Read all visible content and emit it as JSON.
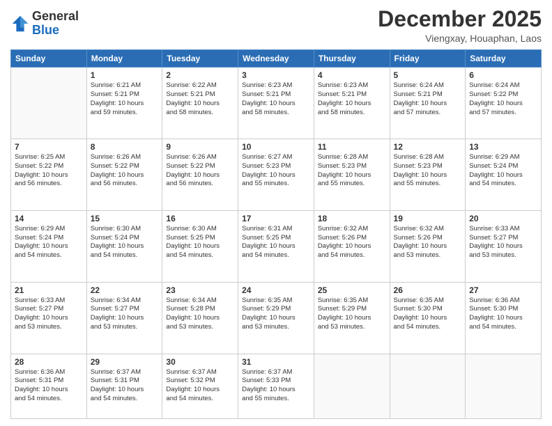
{
  "logo": {
    "general": "General",
    "blue": "Blue"
  },
  "title": "December 2025",
  "subtitle": "Viengxay, Houaphan, Laos",
  "days": [
    "Sunday",
    "Monday",
    "Tuesday",
    "Wednesday",
    "Thursday",
    "Friday",
    "Saturday"
  ],
  "weeks": [
    [
      {
        "day": "",
        "info": ""
      },
      {
        "day": "1",
        "info": "Sunrise: 6:21 AM\nSunset: 5:21 PM\nDaylight: 10 hours\nand 59 minutes."
      },
      {
        "day": "2",
        "info": "Sunrise: 6:22 AM\nSunset: 5:21 PM\nDaylight: 10 hours\nand 58 minutes."
      },
      {
        "day": "3",
        "info": "Sunrise: 6:23 AM\nSunset: 5:21 PM\nDaylight: 10 hours\nand 58 minutes."
      },
      {
        "day": "4",
        "info": "Sunrise: 6:23 AM\nSunset: 5:21 PM\nDaylight: 10 hours\nand 58 minutes."
      },
      {
        "day": "5",
        "info": "Sunrise: 6:24 AM\nSunset: 5:21 PM\nDaylight: 10 hours\nand 57 minutes."
      },
      {
        "day": "6",
        "info": "Sunrise: 6:24 AM\nSunset: 5:22 PM\nDaylight: 10 hours\nand 57 minutes."
      }
    ],
    [
      {
        "day": "7",
        "info": "Sunrise: 6:25 AM\nSunset: 5:22 PM\nDaylight: 10 hours\nand 56 minutes."
      },
      {
        "day": "8",
        "info": "Sunrise: 6:26 AM\nSunset: 5:22 PM\nDaylight: 10 hours\nand 56 minutes."
      },
      {
        "day": "9",
        "info": "Sunrise: 6:26 AM\nSunset: 5:22 PM\nDaylight: 10 hours\nand 56 minutes."
      },
      {
        "day": "10",
        "info": "Sunrise: 6:27 AM\nSunset: 5:23 PM\nDaylight: 10 hours\nand 55 minutes."
      },
      {
        "day": "11",
        "info": "Sunrise: 6:28 AM\nSunset: 5:23 PM\nDaylight: 10 hours\nand 55 minutes."
      },
      {
        "day": "12",
        "info": "Sunrise: 6:28 AM\nSunset: 5:23 PM\nDaylight: 10 hours\nand 55 minutes."
      },
      {
        "day": "13",
        "info": "Sunrise: 6:29 AM\nSunset: 5:24 PM\nDaylight: 10 hours\nand 54 minutes."
      }
    ],
    [
      {
        "day": "14",
        "info": "Sunrise: 6:29 AM\nSunset: 5:24 PM\nDaylight: 10 hours\nand 54 minutes."
      },
      {
        "day": "15",
        "info": "Sunrise: 6:30 AM\nSunset: 5:24 PM\nDaylight: 10 hours\nand 54 minutes."
      },
      {
        "day": "16",
        "info": "Sunrise: 6:30 AM\nSunset: 5:25 PM\nDaylight: 10 hours\nand 54 minutes."
      },
      {
        "day": "17",
        "info": "Sunrise: 6:31 AM\nSunset: 5:25 PM\nDaylight: 10 hours\nand 54 minutes."
      },
      {
        "day": "18",
        "info": "Sunrise: 6:32 AM\nSunset: 5:26 PM\nDaylight: 10 hours\nand 54 minutes."
      },
      {
        "day": "19",
        "info": "Sunrise: 6:32 AM\nSunset: 5:26 PM\nDaylight: 10 hours\nand 53 minutes."
      },
      {
        "day": "20",
        "info": "Sunrise: 6:33 AM\nSunset: 5:27 PM\nDaylight: 10 hours\nand 53 minutes."
      }
    ],
    [
      {
        "day": "21",
        "info": "Sunrise: 6:33 AM\nSunset: 5:27 PM\nDaylight: 10 hours\nand 53 minutes."
      },
      {
        "day": "22",
        "info": "Sunrise: 6:34 AM\nSunset: 5:27 PM\nDaylight: 10 hours\nand 53 minutes."
      },
      {
        "day": "23",
        "info": "Sunrise: 6:34 AM\nSunset: 5:28 PM\nDaylight: 10 hours\nand 53 minutes."
      },
      {
        "day": "24",
        "info": "Sunrise: 6:35 AM\nSunset: 5:29 PM\nDaylight: 10 hours\nand 53 minutes."
      },
      {
        "day": "25",
        "info": "Sunrise: 6:35 AM\nSunset: 5:29 PM\nDaylight: 10 hours\nand 53 minutes."
      },
      {
        "day": "26",
        "info": "Sunrise: 6:35 AM\nSunset: 5:30 PM\nDaylight: 10 hours\nand 54 minutes."
      },
      {
        "day": "27",
        "info": "Sunrise: 6:36 AM\nSunset: 5:30 PM\nDaylight: 10 hours\nand 54 minutes."
      }
    ],
    [
      {
        "day": "28",
        "info": "Sunrise: 6:36 AM\nSunset: 5:31 PM\nDaylight: 10 hours\nand 54 minutes."
      },
      {
        "day": "29",
        "info": "Sunrise: 6:37 AM\nSunset: 5:31 PM\nDaylight: 10 hours\nand 54 minutes."
      },
      {
        "day": "30",
        "info": "Sunrise: 6:37 AM\nSunset: 5:32 PM\nDaylight: 10 hours\nand 54 minutes."
      },
      {
        "day": "31",
        "info": "Sunrise: 6:37 AM\nSunset: 5:33 PM\nDaylight: 10 hours\nand 55 minutes."
      },
      {
        "day": "",
        "info": ""
      },
      {
        "day": "",
        "info": ""
      },
      {
        "day": "",
        "info": ""
      }
    ]
  ]
}
